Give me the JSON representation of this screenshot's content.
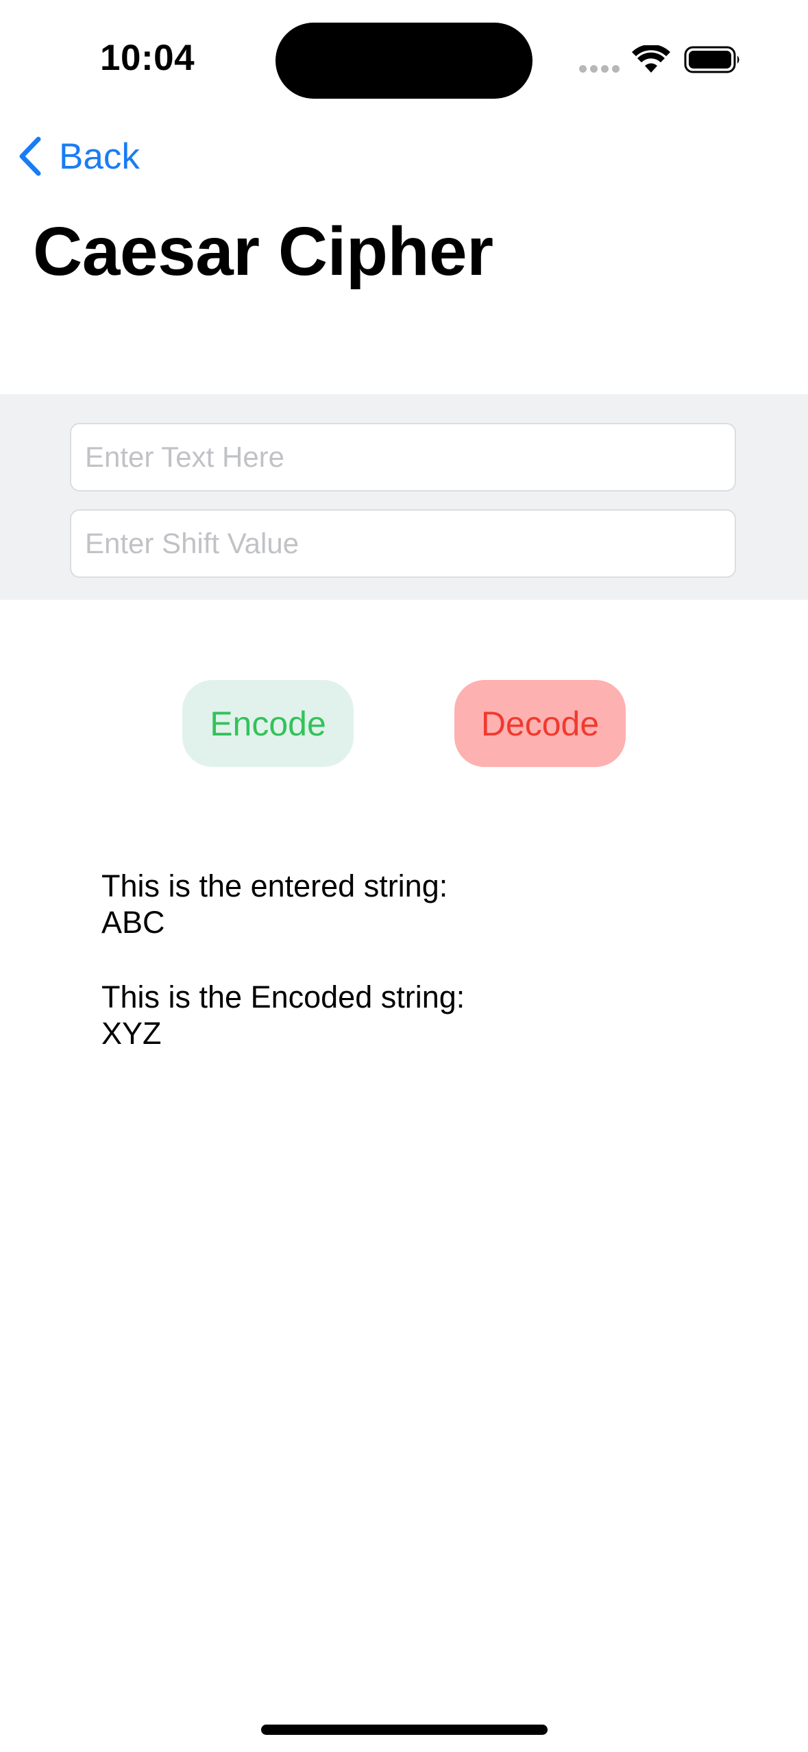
{
  "status_bar": {
    "time": "10:04"
  },
  "nav": {
    "back_label": "Back"
  },
  "page": {
    "title": "Caesar Cipher"
  },
  "form": {
    "text_placeholder": "Enter Text Here",
    "text_value": "",
    "shift_placeholder": "Enter Shift Value",
    "shift_value": ""
  },
  "actions": {
    "encode_label": "Encode",
    "decode_label": "Decode"
  },
  "output": {
    "entered_heading": "This is the entered string:",
    "entered_value": "ABC",
    "encoded_heading": "This is the Encoded string:",
    "encoded_value": "XYZ"
  },
  "colors": {
    "accent_blue": "#1a7cf5",
    "encode_text": "#33c25a",
    "encode_bg": "#e1f2ec",
    "decode_text": "#f03a2f",
    "decode_bg": "#feb1b1",
    "form_bg": "#f0f1f3"
  },
  "icons": {
    "back": "chevron-left-icon",
    "wifi": "wifi-icon",
    "battery": "battery-icon",
    "signal": "signal-dots-icon"
  }
}
